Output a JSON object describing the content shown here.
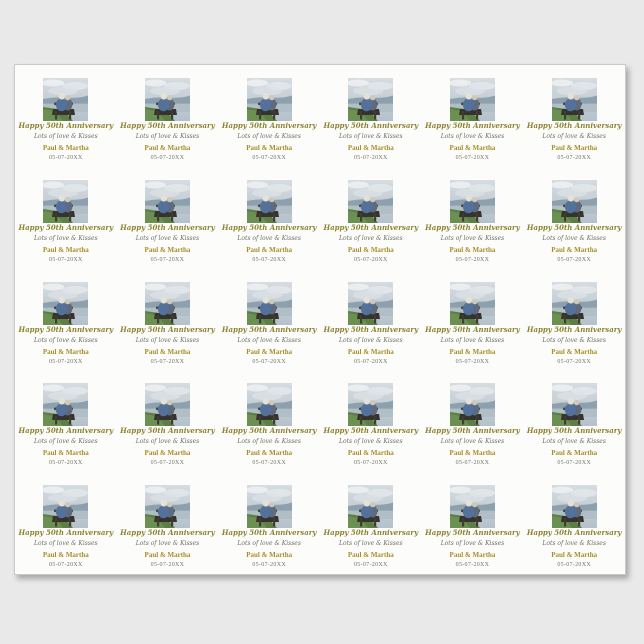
{
  "artboard": {
    "background_color": "#e9e9e9"
  },
  "sheet": {
    "background_color": "#fcfcfa",
    "grid_rows": 5,
    "grid_columns": 6,
    "cell_count": 30
  },
  "label": {
    "heading": "Happy 50th Anniversary",
    "subtitle": "Lots of love & Kisses",
    "names": "Paul & Martha",
    "date": "05-07-20XX",
    "heading_color": "#8e8332",
    "subtitle_color": "#6f6f68",
    "names_color": "#a68e28",
    "date_color": "#73736d"
  },
  "photo": {
    "alt": "Elderly couple seated on a bench overlooking hills and water",
    "sky_color": "#ccd4da",
    "hill_color": "#8da0ae",
    "water_color": "#b2bec6",
    "grass_color": "#5d7f46",
    "bench_color": "#3e3c33",
    "jacket_color": "#54719c",
    "hair_color": "#e6e1d5"
  }
}
